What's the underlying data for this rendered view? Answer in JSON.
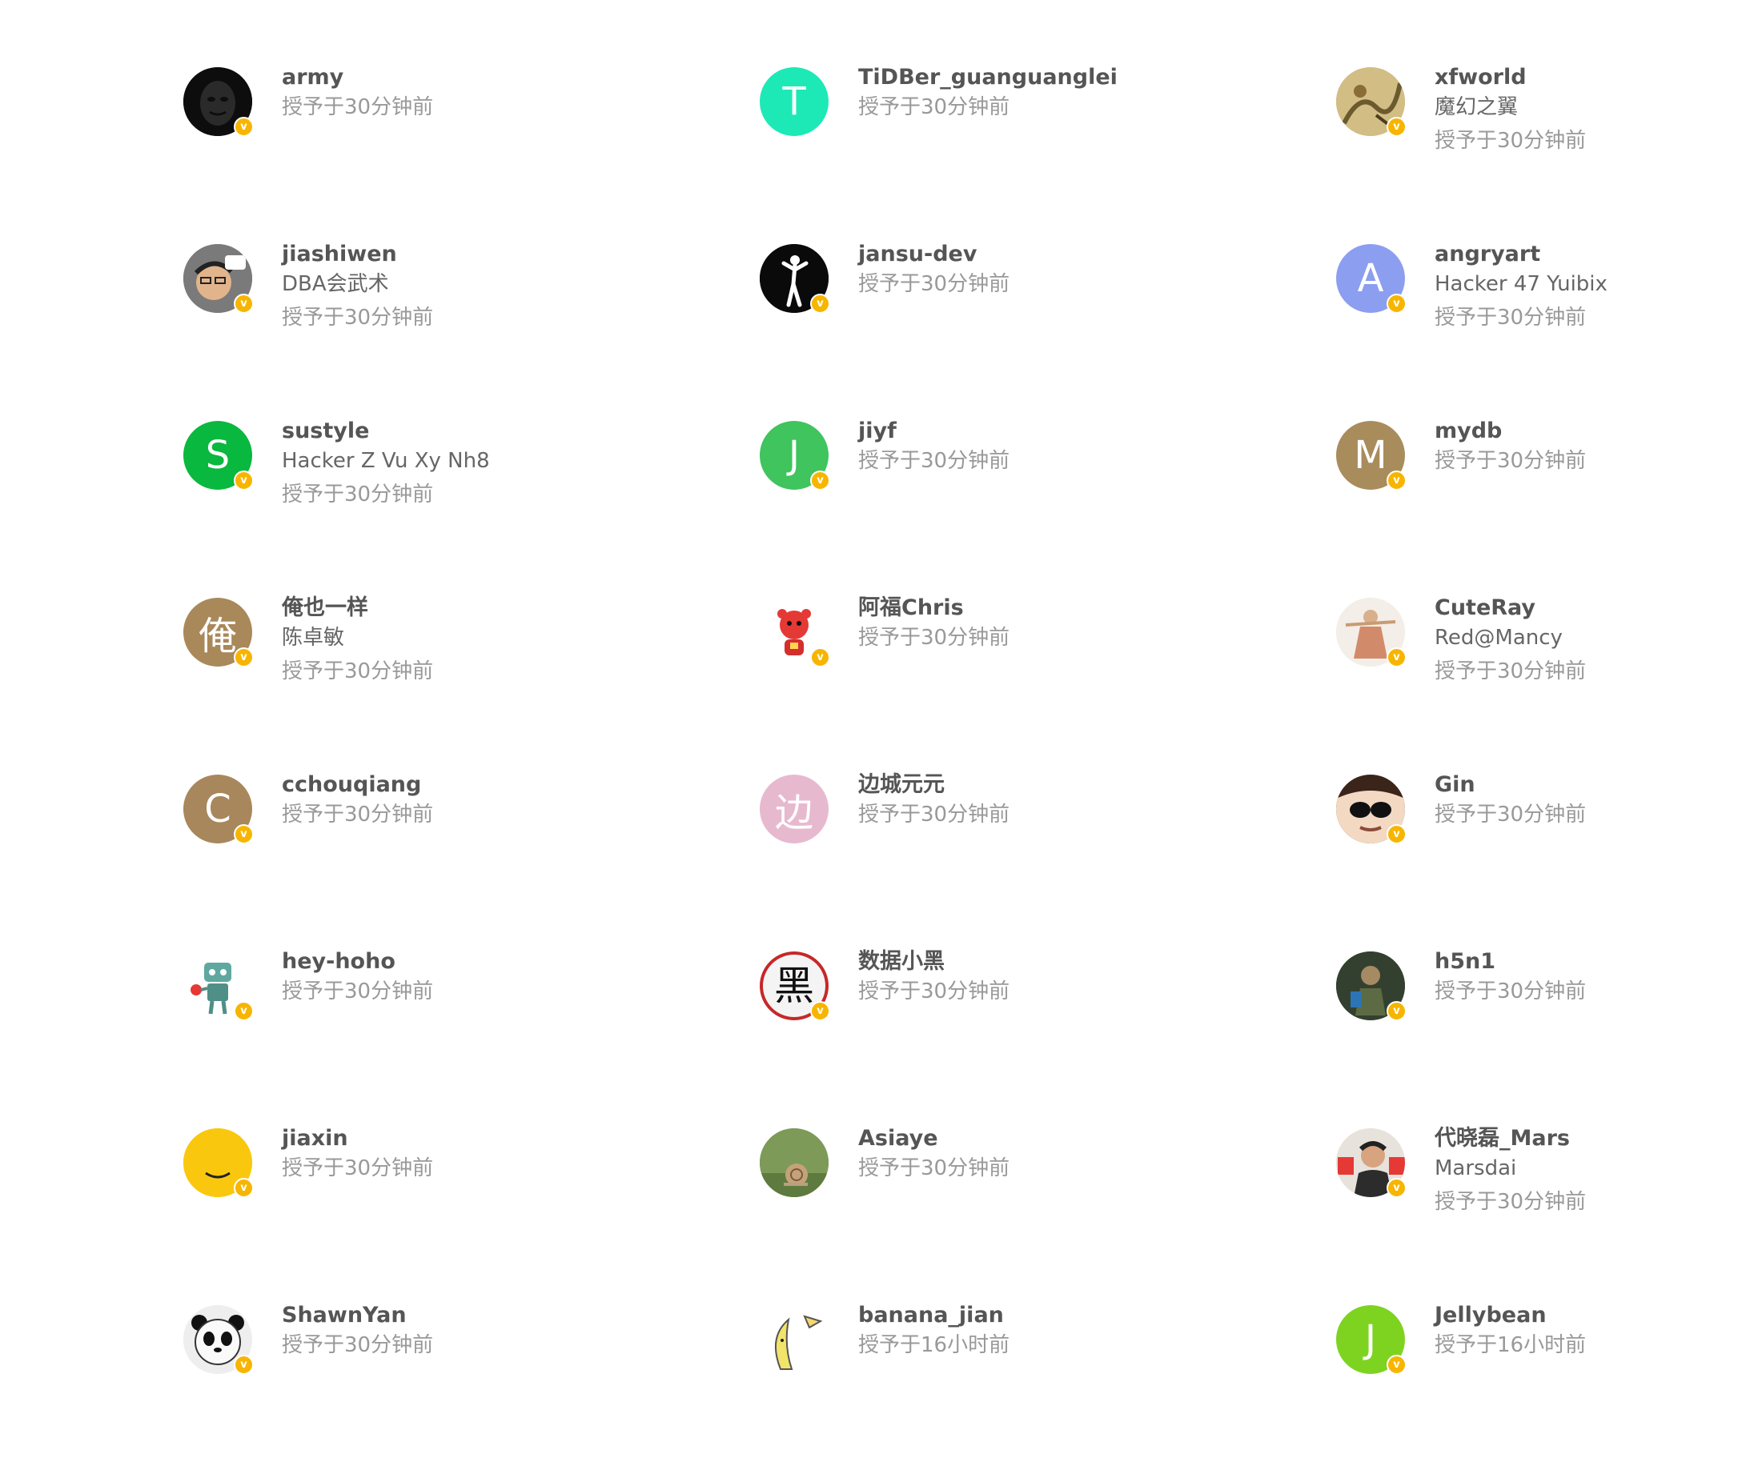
{
  "badges": [
    {
      "name": "army",
      "bio": "",
      "time": "授予于30分钟前",
      "avatar": {
        "letter": "",
        "bg": "#111111",
        "icon": "mask-icon"
      }
    },
    {
      "name": "TiDBer_guanguanglei",
      "bio": "",
      "time": "授予于30分钟前",
      "avatar": {
        "letter": "T",
        "bg": "#1de9b6",
        "icon": "letter-icon"
      },
      "verified": false
    },
    {
      "name": "xfworld",
      "bio": "魔幻之翼",
      "time": "授予于30分钟前",
      "avatar": {
        "letter": "",
        "bg": "#c9b27a",
        "icon": "painting-icon"
      }
    },
    {
      "name": "jiashiwen",
      "bio": "DBA会武术",
      "time": "授予于30分钟前",
      "avatar": {
        "letter": "",
        "bg": "#6d6d6d",
        "icon": "cartoon-man-icon"
      }
    },
    {
      "name": "jansu-dev",
      "bio": "",
      "time": "授予于30分钟前",
      "avatar": {
        "letter": "",
        "bg": "#0a0a0a",
        "icon": "figure-icon"
      }
    },
    {
      "name": "angryart",
      "bio": "Hacker 47 Yuibix",
      "time": "授予于30分钟前",
      "avatar": {
        "letter": "A",
        "bg": "#8c9eef",
        "icon": "letter-icon"
      }
    },
    {
      "name": "sustyle",
      "bio": "Hacker Z Vu Xy Nh8",
      "time": "授予于30分钟前",
      "avatar": {
        "letter": "S",
        "bg": "#09b83e",
        "icon": "letter-icon"
      }
    },
    {
      "name": "jiyf",
      "bio": "",
      "time": "授予于30分钟前",
      "avatar": {
        "letter": "J",
        "bg": "#3fc45e",
        "icon": "letter-icon"
      }
    },
    {
      "name": "mydb",
      "bio": "",
      "time": "授予于30分钟前",
      "avatar": {
        "letter": "M",
        "bg": "#a88c5c",
        "icon": "letter-icon"
      }
    },
    {
      "name": "俺也一样",
      "bio": "陈卓敏",
      "time": "授予于30分钟前",
      "avatar": {
        "letter": "俺",
        "bg": "#a9885a",
        "icon": "letter-icon"
      }
    },
    {
      "name": "阿福Chris",
      "bio": "",
      "time": "授予于30分钟前",
      "avatar": {
        "letter": "",
        "bg": "#ffffff",
        "icon": "tiger-icon"
      }
    },
    {
      "name": "CuteRay",
      "bio": "Red@Mancy",
      "time": "授予于30分钟前",
      "avatar": {
        "letter": "",
        "bg": "#f2ede6",
        "icon": "figurine-icon"
      }
    },
    {
      "name": "cchouqiang",
      "bio": "",
      "time": "授予于30分钟前",
      "avatar": {
        "letter": "C",
        "bg": "#a8875c",
        "icon": "letter-icon"
      }
    },
    {
      "name": "边城元元",
      "bio": "",
      "time": "授予于30分钟前",
      "avatar": {
        "letter": "边",
        "bg": "#e7b9cf",
        "icon": "letter-icon"
      },
      "verified": false
    },
    {
      "name": "Gin",
      "bio": "",
      "time": "授予于30分钟前",
      "avatar": {
        "letter": "",
        "bg": "#4a2e22",
        "icon": "sunglasses-icon"
      }
    },
    {
      "name": "hey-hoho",
      "bio": "",
      "time": "授予于30分钟前",
      "avatar": {
        "letter": "",
        "bg": "#ffffff",
        "icon": "robot-icon"
      }
    },
    {
      "name": "数据小黑",
      "bio": "",
      "time": "授予于30分钟前",
      "avatar": {
        "letter": "黑",
        "bg": "#f4f4f4",
        "icon": "hei-character-icon"
      }
    },
    {
      "name": "h5n1",
      "bio": "",
      "time": "授予于30分钟前",
      "avatar": {
        "letter": "",
        "bg": "#2f3a2c",
        "icon": "soldier-icon"
      }
    },
    {
      "name": "jiaxin",
      "bio": "",
      "time": "授予于30分钟前",
      "avatar": {
        "letter": "",
        "bg": "#f9c80e",
        "icon": "smile-icon"
      }
    },
    {
      "name": "Asiaye",
      "bio": "",
      "time": "授予于30分钟前",
      "avatar": {
        "letter": "",
        "bg": "#6f8a4e",
        "icon": "snail-icon"
      },
      "verified": false
    },
    {
      "name": "代晓磊_Mars",
      "bio": "Marsdai",
      "time": "授予于30分钟前",
      "avatar": {
        "letter": "",
        "bg": "#d9d2cc",
        "icon": "person-photo-icon"
      }
    },
    {
      "name": "ShawnYan",
      "bio": "",
      "time": "授予于30分钟前",
      "avatar": {
        "letter": "",
        "bg": "#eeeeee",
        "icon": "panda-icon"
      }
    },
    {
      "name": "banana_jian",
      "bio": "",
      "time": "授予于16小时前",
      "avatar": {
        "letter": "",
        "bg": "#ffffff",
        "icon": "banana-icon"
      },
      "verified": false
    },
    {
      "name": "Jellybean",
      "bio": "",
      "time": "授予于16小时前",
      "avatar": {
        "letter": "J",
        "bg": "#7ed321",
        "icon": "letter-icon"
      }
    }
  ],
  "verified_mark": "v",
  "colors": {
    "name": "#555555",
    "bio": "#666666",
    "time": "#999999",
    "verified": "#f7b500"
  }
}
